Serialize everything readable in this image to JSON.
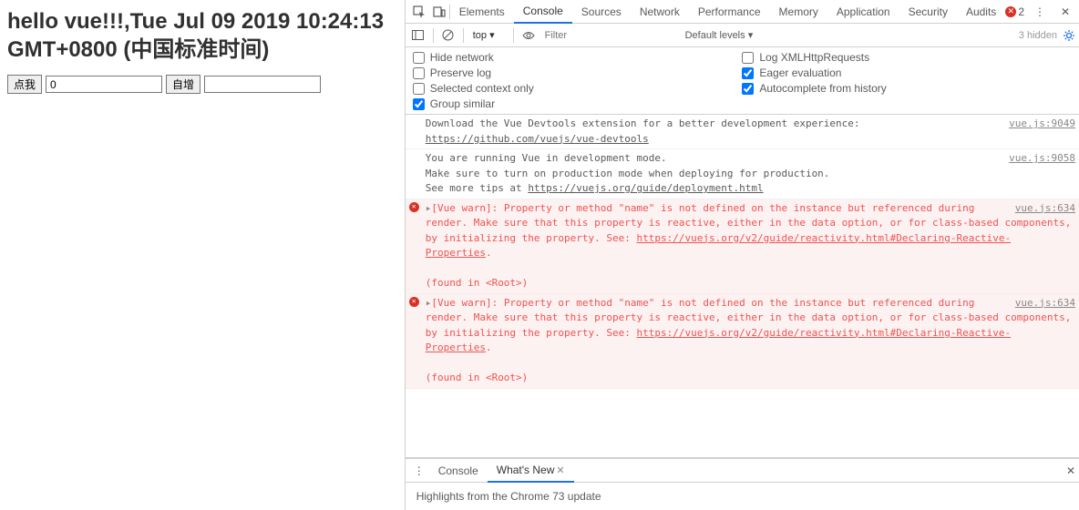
{
  "app": {
    "title": "hello vue!!!,Tue Jul 09 2019 10:24:13 GMT+0800 (中国标准时间)",
    "button1": "点我",
    "input1_value": "0",
    "button2": "自增",
    "input2_value": ""
  },
  "devtools": {
    "tabs": [
      "Elements",
      "Console",
      "Sources",
      "Network",
      "Performance",
      "Memory",
      "Application",
      "Security",
      "Audits"
    ],
    "active_tab": "Console",
    "error_count": "2",
    "toolbar": {
      "context": "top",
      "filter_placeholder": "Filter",
      "levels": "Default levels",
      "hidden": "3 hidden"
    },
    "settings": {
      "left": [
        "Hide network",
        "Preserve log",
        "Selected context only",
        "Group similar"
      ],
      "right": [
        "Log XMLHttpRequests",
        "Eager evaluation",
        "Autocomplete from history"
      ],
      "checked_left": [
        false,
        false,
        false,
        true
      ],
      "checked_right": [
        false,
        true,
        true
      ]
    },
    "logs": [
      {
        "type": "info",
        "source": "vue.js:9049",
        "text": "Download the Vue Devtools extension for a better development experience:",
        "link": "https://github.com/vuejs/vue-devtools"
      },
      {
        "type": "info",
        "source": "vue.js:9058",
        "lines": [
          "You are running Vue in development mode.",
          "Make sure to turn on production mode when deploying for production."
        ],
        "tip_prefix": "See more tips at ",
        "tip_link": "https://vuejs.org/guide/deployment.html"
      },
      {
        "type": "error",
        "source": "vue.js:634",
        "warn_prefix": "[Vue warn]: Property or method \"name\" is not defined on the instance but referenced during render. Make sure that this property is reactive, either in the data option, or for class-based components, by initializing the property. See: ",
        "warn_link": "https://vuejs.org/v2/guide/reactivity.html#Declaring-Reactive-Properties",
        "warn_suffix": ".",
        "found": "(found in <Root>)"
      },
      {
        "type": "error",
        "source": "vue.js:634",
        "warn_prefix": "[Vue warn]: Property or method \"name\" is not defined on the instance but referenced during render. Make sure that this property is reactive, either in the data option, or for class-based components, by initializing the property. See: ",
        "warn_link": "https://vuejs.org/v2/guide/reactivity.html#Declaring-Reactive-Properties",
        "warn_suffix": ".",
        "found": "(found in <Root>)"
      }
    ],
    "drawer": {
      "tabs": [
        "Console",
        "What's New"
      ],
      "active": "What's New",
      "body": "Highlights from the Chrome 73 update"
    }
  }
}
